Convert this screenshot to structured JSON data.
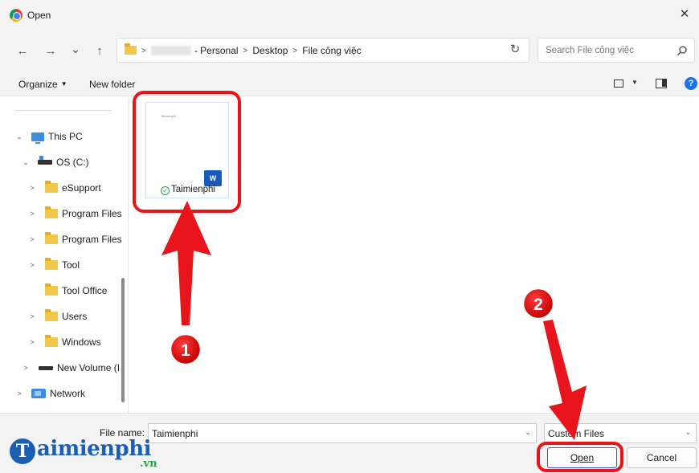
{
  "window": {
    "title": "Open",
    "close_glyph": "✕"
  },
  "nav": {
    "back_glyph": "←",
    "forward_glyph": "→",
    "recent_glyph": "⌄",
    "up_glyph": "↑",
    "breadcrumbs": [
      "- Personal",
      "Desktop",
      "File công việc"
    ],
    "separator": ">",
    "dropdown_glyph": "⌄",
    "refresh_glyph": "↻",
    "search_placeholder": "Search File công việc"
  },
  "toolbar": {
    "organize_label": "Organize",
    "new_folder_label": "New folder",
    "help_glyph": "?"
  },
  "sidebar": {
    "items": [
      {
        "label": "This PC",
        "icon": "pc-icon",
        "chevron": "⌄"
      },
      {
        "label": "OS (C:)",
        "icon": "drive-icon",
        "chevron": "⌄"
      },
      {
        "label": "eSupport",
        "icon": "folder-icon",
        "chevron": ">"
      },
      {
        "label": "Program Files",
        "icon": "folder-icon",
        "chevron": ">"
      },
      {
        "label": "Program Files",
        "icon": "folder-icon",
        "chevron": ">"
      },
      {
        "label": "Tool",
        "icon": "folder-icon",
        "chevron": ">"
      },
      {
        "label": "Tool Office",
        "icon": "folder-icon",
        "chevron": ""
      },
      {
        "label": "Users",
        "icon": "folder-icon",
        "chevron": ">"
      },
      {
        "label": "Windows",
        "icon": "folder-icon",
        "chevron": ">"
      },
      {
        "label": "New Volume (I",
        "icon": "hdd-icon",
        "chevron": ">"
      },
      {
        "label": "Network",
        "icon": "network-icon",
        "chevron": ">"
      }
    ]
  },
  "files": [
    {
      "name": "Taimienphi",
      "type_icon": "word-icon",
      "status_icon": "sync-ok-icon",
      "thumb_text": "Taimienphi",
      "word_letter": "W"
    }
  ],
  "footer": {
    "file_name_label": "File name:",
    "file_name_value": "Taimienphi",
    "file_type_value": "Custom Files",
    "open_label": "Open",
    "cancel_label": "Cancel"
  },
  "annotations": [
    {
      "number": "1",
      "target": "file-tile"
    },
    {
      "number": "2",
      "target": "open-button"
    }
  ],
  "watermark": {
    "brand": "Taimienphi",
    "brand_initial": "T",
    "brand_rest": "aimienphi",
    "suffix": ".vn"
  },
  "colors": {
    "highlight_red": "#e8141c",
    "brand_blue": "#1a5fb4",
    "brand_green": "#2ea043",
    "folder_yellow": "#f2c84b",
    "accent_blue": "#1a73e8"
  }
}
